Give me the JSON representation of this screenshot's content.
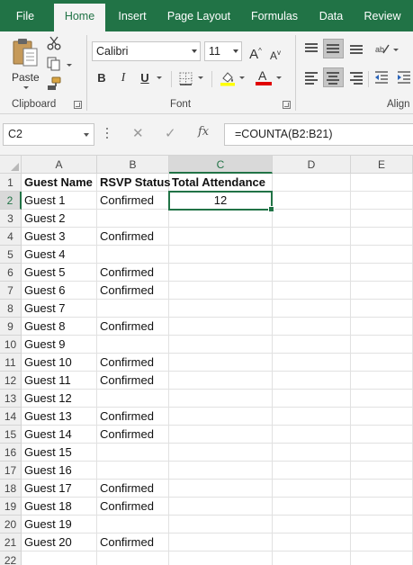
{
  "menu": {
    "tabs": [
      {
        "label": "File"
      },
      {
        "label": "Home"
      },
      {
        "label": "Insert"
      },
      {
        "label": "Page Layout"
      },
      {
        "label": "Formulas"
      },
      {
        "label": "Data"
      },
      {
        "label": "Review"
      }
    ],
    "active_tab": "Home"
  },
  "ribbon": {
    "paste_label": "Paste",
    "clipboard_label": "Clipboard",
    "font_label": "Font",
    "alignment_label": "Align",
    "font_name": "Calibri",
    "font_size": "11",
    "grow_font": "A",
    "shrink_font": "A",
    "bold": "B",
    "italic": "I",
    "underline": "U",
    "font_color_letter": "A",
    "highlight_color": "#ffff00",
    "font_color": "#e00000"
  },
  "formula_bar": {
    "name_box": "C2",
    "fx_label": "fx",
    "formula": "=COUNTA(B2:B21)"
  },
  "sheet": {
    "columns": [
      "A",
      "B",
      "C",
      "D",
      "E"
    ],
    "rows": [
      [
        "Guest Name",
        "RSVP Status",
        "Total Attendance",
        "",
        ""
      ],
      [
        "Guest 1",
        "Confirmed",
        "12",
        "",
        ""
      ],
      [
        "Guest 2",
        "",
        "",
        "",
        ""
      ],
      [
        "Guest 3",
        "Confirmed",
        "",
        "",
        ""
      ],
      [
        "Guest 4",
        "",
        "",
        "",
        ""
      ],
      [
        "Guest 5",
        "Confirmed",
        "",
        "",
        ""
      ],
      [
        "Guest 6",
        "Confirmed",
        "",
        "",
        ""
      ],
      [
        "Guest 7",
        "",
        "",
        "",
        ""
      ],
      [
        "Guest 8",
        "Confirmed",
        "",
        "",
        ""
      ],
      [
        "Guest 9",
        "",
        "",
        "",
        ""
      ],
      [
        "Guest 10",
        "Confirmed",
        "",
        "",
        ""
      ],
      [
        "Guest 11",
        "Confirmed",
        "",
        "",
        ""
      ],
      [
        "Guest 12",
        "",
        "",
        "",
        ""
      ],
      [
        "Guest 13",
        "Confirmed",
        "",
        "",
        ""
      ],
      [
        "Guest 14",
        "Confirmed",
        "",
        "",
        ""
      ],
      [
        "Guest 15",
        "",
        "",
        "",
        ""
      ],
      [
        "Guest 16",
        "",
        "",
        "",
        ""
      ],
      [
        "Guest 17",
        "Confirmed",
        "",
        "",
        ""
      ],
      [
        "Guest 18",
        "Confirmed",
        "",
        "",
        ""
      ],
      [
        "Guest 19",
        "",
        "",
        "",
        ""
      ],
      [
        "Guest 20",
        "Confirmed",
        "",
        "",
        ""
      ],
      [
        "",
        "",
        "",
        "",
        ""
      ]
    ],
    "selected_cell": "C2",
    "accent_color": "#217346"
  }
}
